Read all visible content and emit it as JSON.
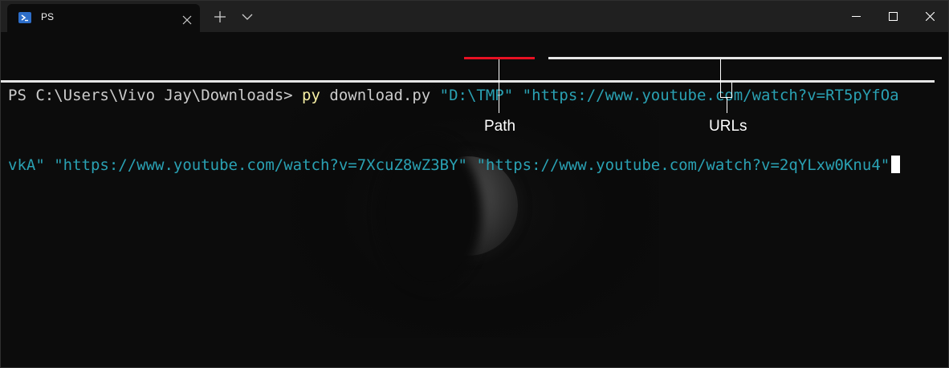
{
  "window": {
    "tab_title": "PS",
    "tab_icon": "powershell-icon",
    "controls": [
      "minimize-icon",
      "maximize-icon",
      "close-icon"
    ]
  },
  "terminal": {
    "prompt": "PS C:\\Users\\Vivo Jay\\Downloads> ",
    "command": "py",
    "script": " download.py ",
    "path_arg": "\"D:\\TMP\"",
    "line1_url": "\"https://www.youtube.com/watch?v=RT5pYfOa",
    "line2_url1_end": "vkA\"",
    "url2": "\"https://www.youtube.com/watch?v=7XcuZ8wZ3BY\"",
    "url3": "\"https://www.youtube.com/watch?v=2qYLxw0Knu4\""
  },
  "annotations": {
    "path_label": "Path",
    "urls_label": "URLs"
  },
  "colors": {
    "background": "#0c0c0c",
    "titlebar": "#202020",
    "command": "#f9f1a5",
    "string": "#2aa1b3",
    "path_underline": "#e81123",
    "urls_underline": "#e6e6e6"
  }
}
